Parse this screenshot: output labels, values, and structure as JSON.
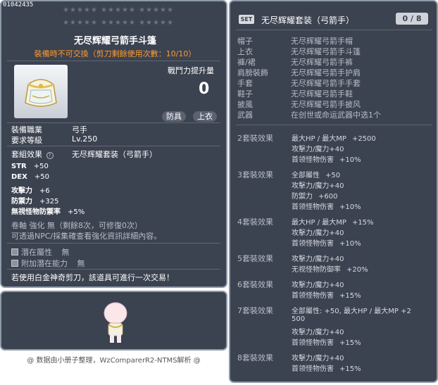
{
  "item_id": "01042435",
  "stars_row1": "★★★★★ ★★★★★ ★★★★★",
  "stars_row2": "★★★★★ ★★★★★ ★★★★★",
  "title": "无尽辉耀弓箭手斗篷",
  "trade_note": "裝備時不可交換（剪刀剩餘使用次數：10/10）",
  "power_label": "戰鬥力提升量",
  "power_value": "0",
  "tags": [
    "防具",
    "上衣"
  ],
  "info": [
    {
      "label": "裝備職業",
      "value": "弓手"
    },
    {
      "label": "要求等級",
      "value": "Lv.250"
    },
    {
      "label": "套組效果",
      "value": "无尽辉耀套装（弓箭手）"
    }
  ],
  "stats": [
    {
      "name": "STR",
      "value": "+50"
    },
    {
      "name": "DEX",
      "value": "+50"
    },
    {
      "name": "攻擊力",
      "value": "+6"
    },
    {
      "name": "防禦力",
      "value": "+325"
    },
    {
      "name": "無視怪物防禦率",
      "value": "+5%"
    }
  ],
  "scroll_line": "卷軸 強化 無（剩餘8次，可修復0次）",
  "star_note": "可透過NPC/採集確查看強化資訊詳細內容。",
  "potential": {
    "label": "潛在屬性",
    "value": "無"
  },
  "additional": {
    "label": "附加潛在能力",
    "value": "無"
  },
  "platinum_note": "若使用白金神奇剪刀，該道具可進行一次交易！",
  "footer": "@ 数据由小册子整理，WzComparerR2-NTMS解析 @",
  "set_panel": {
    "badge": "SET",
    "title": "无尽辉耀套装（弓箭手）",
    "count": "0 / 8",
    "pieces": [
      {
        "slot": "帽子",
        "name": "无尽辉耀弓箭手帽"
      },
      {
        "slot": "上衣",
        "name": "无尽辉耀弓箭手斗篷"
      },
      {
        "slot": "褲/裙",
        "name": "无尽辉耀弓箭手裤"
      },
      {
        "slot": "肩膀裝飾",
        "name": "无尽辉耀弓箭手护肩"
      },
      {
        "slot": "手套",
        "name": "无尽辉耀弓箭手手套"
      },
      {
        "slot": "鞋子",
        "name": "无尽辉耀弓箭手鞋"
      },
      {
        "slot": "披風",
        "name": "无尽辉耀弓箭手披风"
      },
      {
        "slot": "武器",
        "name": "在创世或命运武器中选1个"
      }
    ],
    "effects": [
      {
        "label": "2套裝效果",
        "lines": [
          {
            "t": "最大HP / 最大MP",
            "v": "+2500"
          },
          {
            "t": "攻擊力/魔力+40",
            "v": ""
          },
          {
            "t": "首领怪物伤害",
            "v": "+10%"
          }
        ]
      },
      {
        "label": "3套裝效果",
        "lines": [
          {
            "t": "全部屬性",
            "v": "+50"
          },
          {
            "t": "攻擊力/魔力+40",
            "v": ""
          },
          {
            "t": "防禦力",
            "v": "+600"
          },
          {
            "t": "首领怪物伤害",
            "v": "+10%"
          }
        ]
      },
      {
        "label": "4套裝效果",
        "lines": [
          {
            "t": "最大HP / 最大MP",
            "v": "+15%"
          },
          {
            "t": "攻擊力/魔力+40",
            "v": ""
          },
          {
            "t": "首领怪物伤害",
            "v": "+10%"
          }
        ]
      },
      {
        "label": "5套裝效果",
        "lines": [
          {
            "t": "攻擊力/魔力+40",
            "v": ""
          },
          {
            "t": "无视怪物防御率",
            "v": "+20%"
          }
        ]
      },
      {
        "label": "6套裝效果",
        "lines": [
          {
            "t": "攻擊力/魔力+40",
            "v": ""
          },
          {
            "t": "首领怪物伤害",
            "v": "+15%"
          }
        ]
      },
      {
        "label": "7套裝效果",
        "lines": [
          {
            "t": "全部屬性: +50, 最大HP / 最大MP  +2",
            "v": ""
          },
          {
            "t": "500",
            "v": ""
          },
          {
            "t": "攻擊力/魔力+40",
            "v": ""
          },
          {
            "t": "首领怪物伤害",
            "v": "+15%"
          }
        ]
      },
      {
        "label": "8套裝效果",
        "lines": [
          {
            "t": "攻擊力/魔力+40",
            "v": ""
          },
          {
            "t": "首领怪物伤害",
            "v": "+15%"
          }
        ]
      }
    ]
  }
}
